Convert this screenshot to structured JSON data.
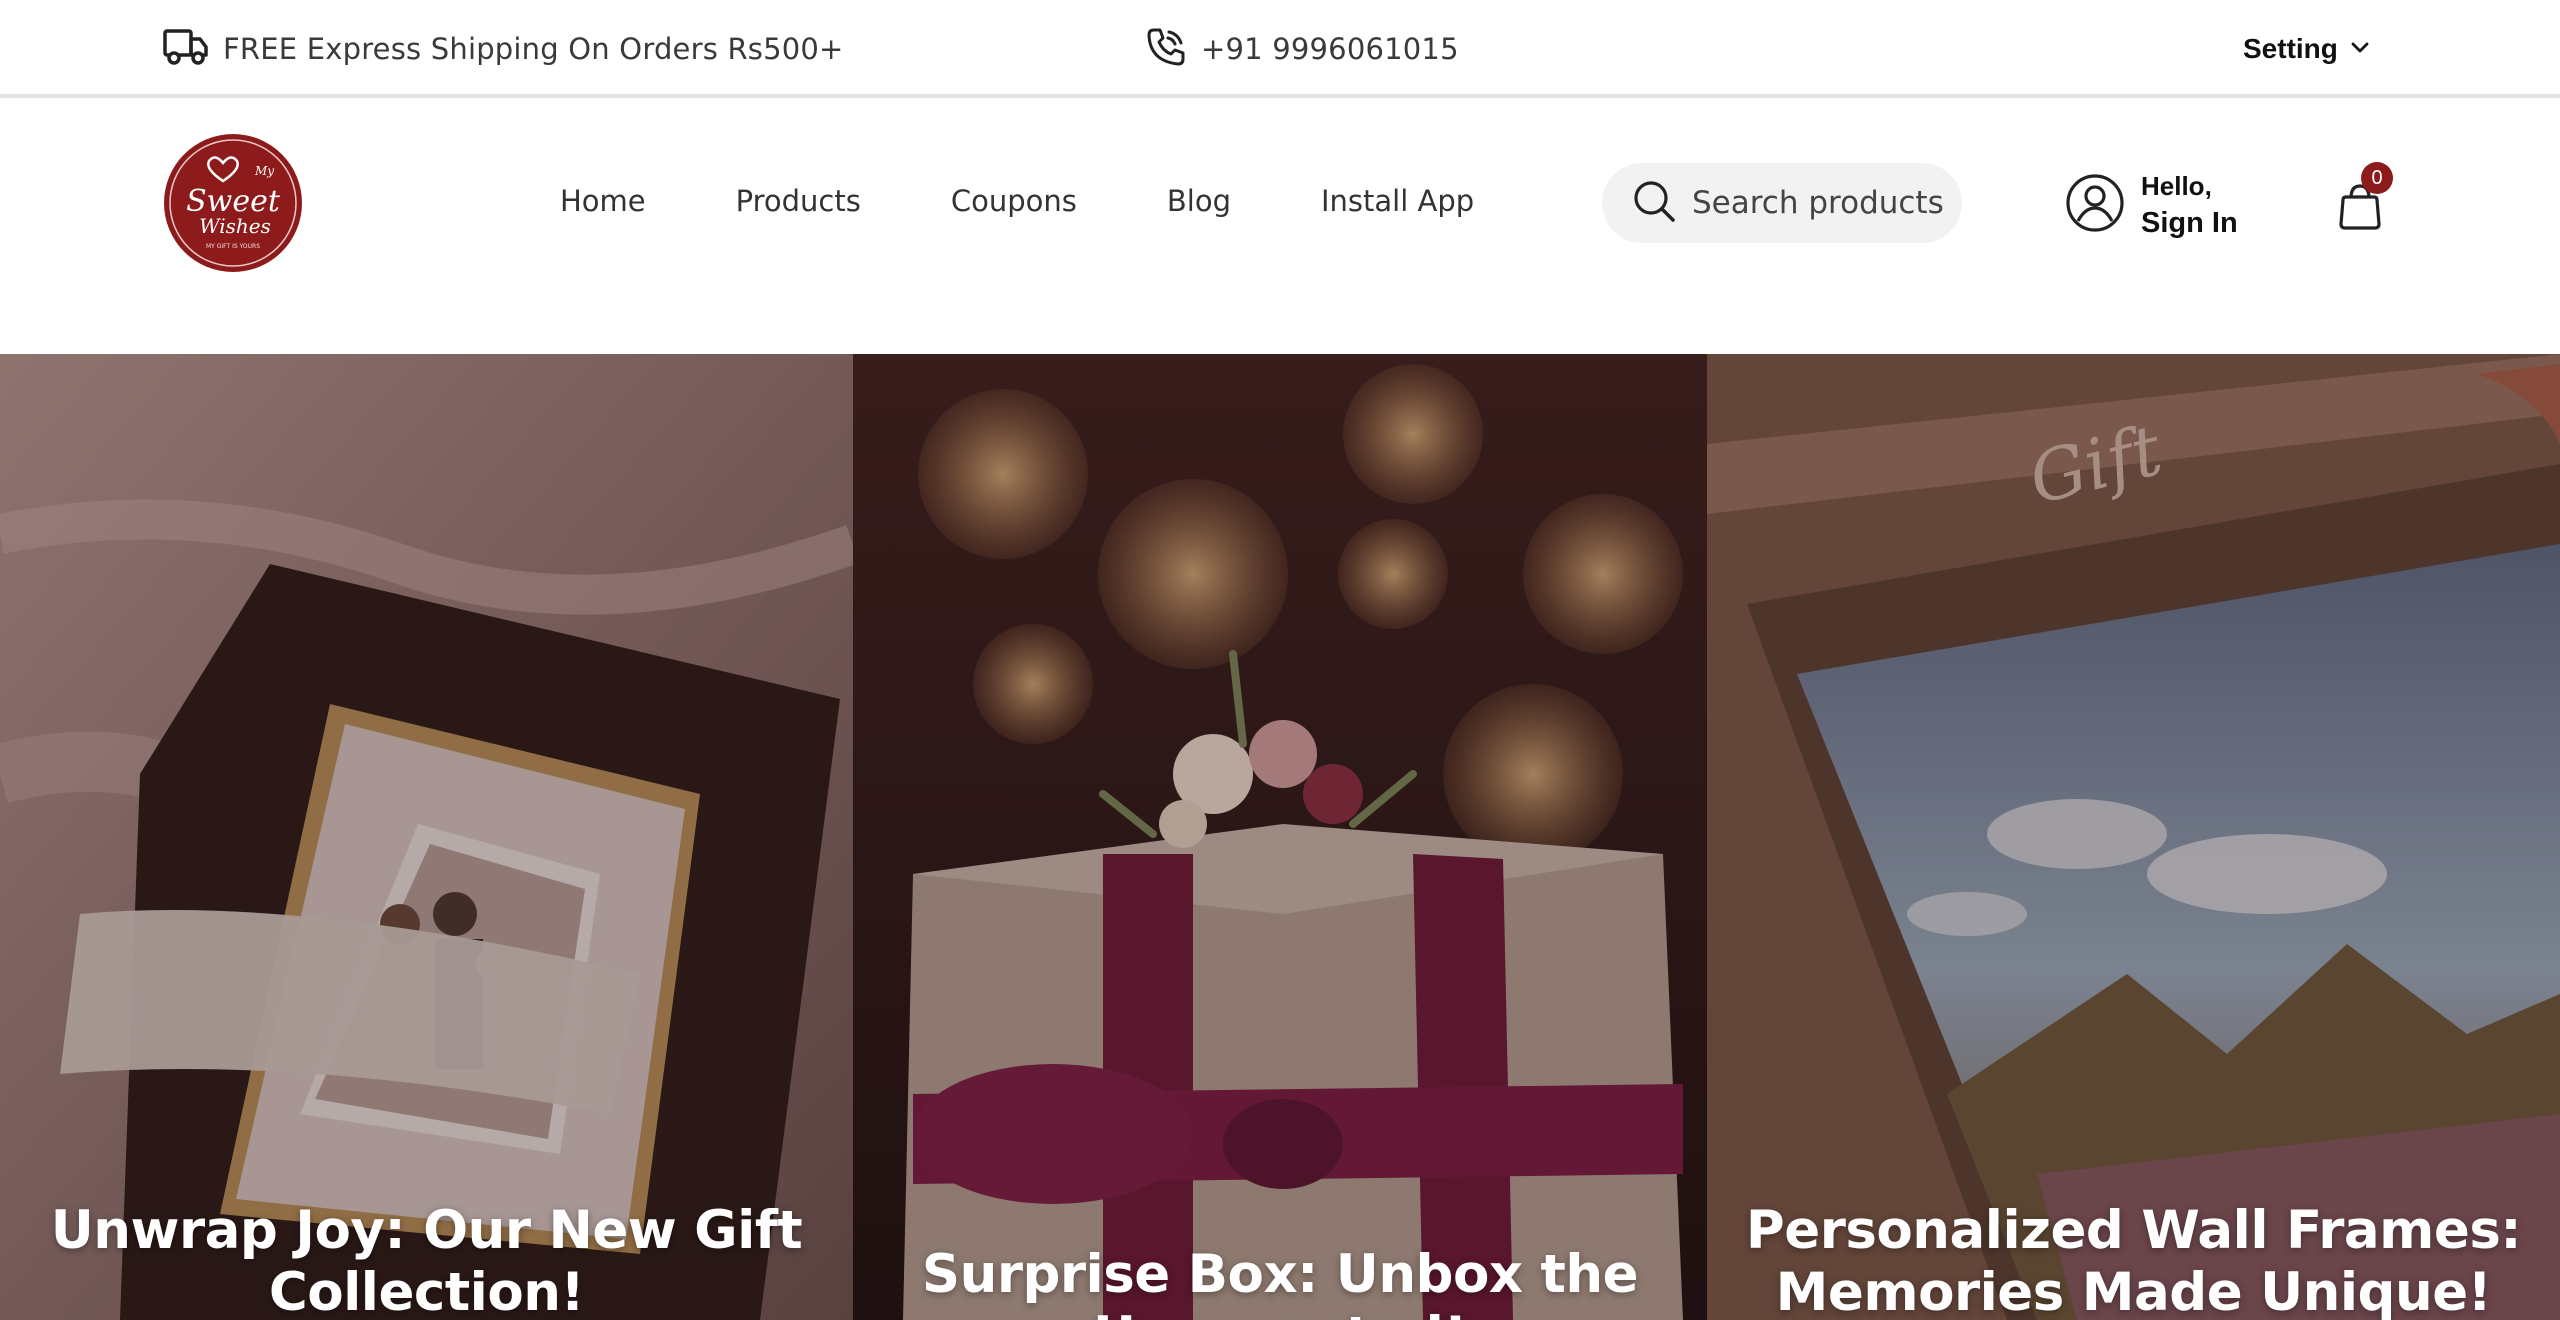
{
  "topbar": {
    "shipping_icon": "truck-icon",
    "shipping_text": "FREE Express Shipping On Orders Rs500+",
    "phone_icon": "phone-icon",
    "phone_text": "+91 9996061015",
    "setting_label": "Setting",
    "setting_icon": "chevron-down-icon"
  },
  "header": {
    "logo": {
      "my": "My",
      "sweet": "Sweet",
      "wishes": "Wishes",
      "tagline": "MY GIFT IS YOURS"
    },
    "nav": [
      {
        "label": "Home"
      },
      {
        "label": "Products"
      },
      {
        "label": "Coupons"
      },
      {
        "label": "Blog"
      },
      {
        "label": "Install App"
      }
    ],
    "search": {
      "placeholder": "Search products",
      "icon": "search-icon"
    },
    "account": {
      "greeting": "Hello,",
      "action": "Sign In",
      "icon": "user-icon"
    },
    "cart": {
      "count": "0",
      "icon": "shopping-bag-icon"
    }
  },
  "hero": {
    "slides": [
      {
        "title_line1": "Unwrap Joy: Our New Gift",
        "title_line2": "Collection!"
      },
      {
        "title_line1": "Surprise Box: Unbox the",
        "title_line2": "Unexpected!"
      },
      {
        "title_line1": "Personalized Wall Frames:",
        "title_line2": "Memories Made Unique!"
      }
    ]
  },
  "colors": {
    "brand": "#8e1b1b",
    "search_bg": "#f2f2f2",
    "text": "#333333"
  }
}
